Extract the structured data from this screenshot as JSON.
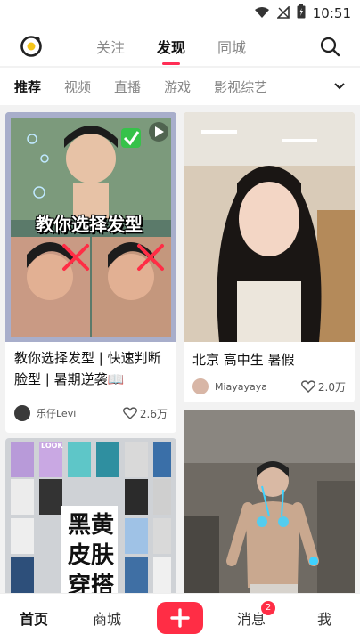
{
  "status_bar": {
    "time": "10:51"
  },
  "top_tabs": [
    {
      "label": "关注",
      "active": false
    },
    {
      "label": "发现",
      "active": true
    },
    {
      "label": "同城",
      "active": false
    }
  ],
  "categories": [
    {
      "label": "推荐",
      "active": true
    },
    {
      "label": "视频",
      "active": false
    },
    {
      "label": "直播",
      "active": false
    },
    {
      "label": "游戏",
      "active": false
    },
    {
      "label": "影视综艺",
      "active": false
    }
  ],
  "cards": [
    {
      "title": "教你选择发型 | 快速判断脸型 | 暑期逆袭📖",
      "overlay_text": "教你选择发型",
      "author": "乐仔Levi",
      "likes": "2.6万"
    },
    {
      "title": "北京 高中生 暑假",
      "author": "Miayayaya",
      "likes": "2.0万"
    },
    {
      "overlay_label": "LOOK",
      "overlay_text_lines": [
        "黑黄",
        "皮肤",
        "穿搭"
      ]
    },
    {}
  ],
  "bottom_nav": {
    "home": "首页",
    "mall": "商城",
    "messages": "消息",
    "messages_badge": "2",
    "me": "我"
  },
  "colors": {
    "accent": "#ff2d45"
  }
}
